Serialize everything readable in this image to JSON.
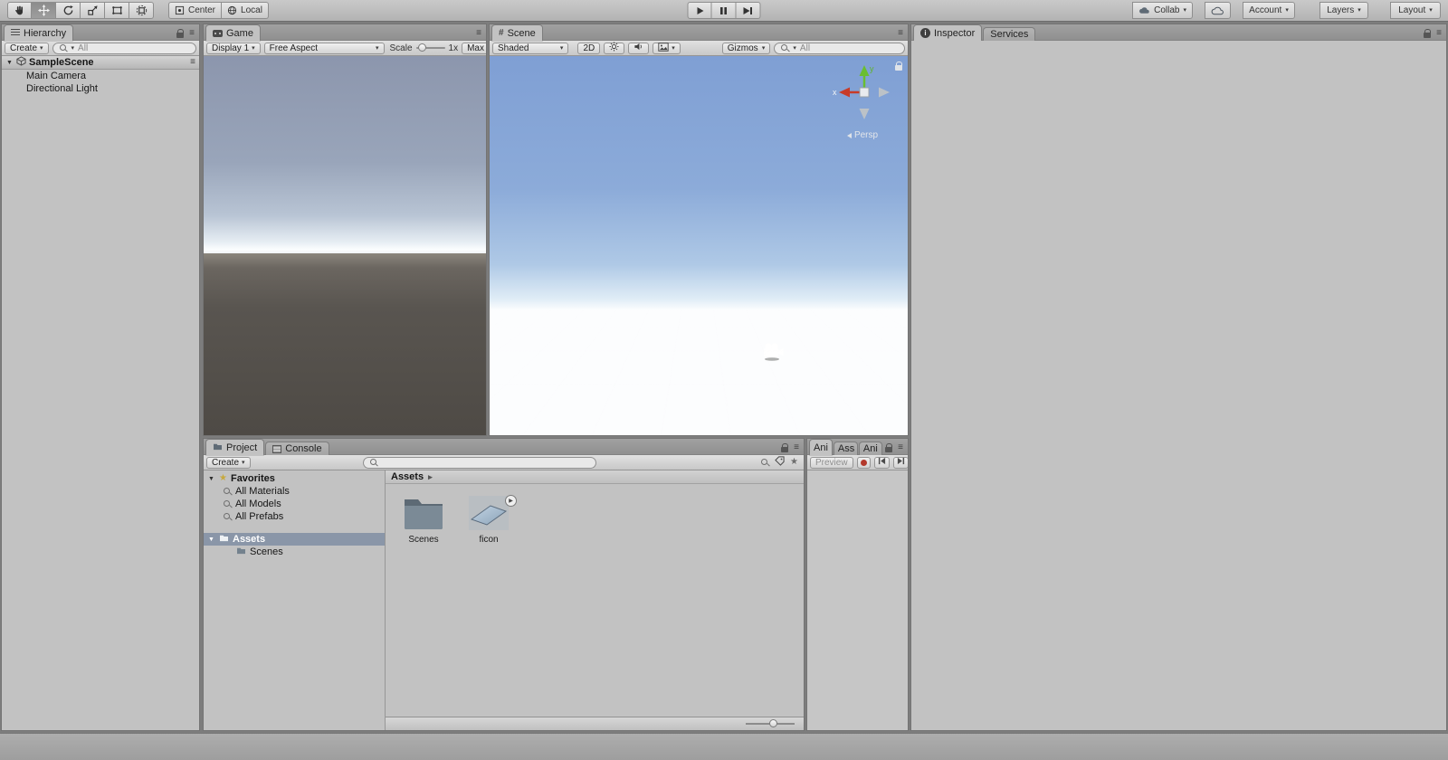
{
  "toolbar": {
    "pivot_label": "Center",
    "space_label": "Local",
    "collab_label": "Collab",
    "account_label": "Account",
    "layers_label": "Layers",
    "layout_label": "Layout"
  },
  "hierarchy": {
    "tab_label": "Hierarchy",
    "create_label": "Create",
    "search_placeholder": "All",
    "scene_name": "SampleScene",
    "items": [
      {
        "label": "Main Camera"
      },
      {
        "label": "Directional Light"
      }
    ]
  },
  "game": {
    "tab_label": "Game",
    "display_label": "Display 1",
    "aspect_label": "Free Aspect",
    "scale_label": "Scale",
    "scale_value": "1x",
    "maximize_label": "Max"
  },
  "scene": {
    "tab_label": "Scene",
    "shading_label": "Shaded",
    "mode_2d_label": "2D",
    "gizmos_label": "Gizmos",
    "search_placeholder": "All",
    "persp_label": "Persp",
    "axis_x_label": "x",
    "axis_y_label": "y"
  },
  "project": {
    "tab_label": "Project",
    "console_tab_label": "Console",
    "create_label": "Create",
    "favorites_label": "Favorites",
    "favorites_items": [
      {
        "label": "All Materials"
      },
      {
        "label": "All Models"
      },
      {
        "label": "All Prefabs"
      }
    ],
    "assets_label": "Assets",
    "assets_children": [
      {
        "label": "Scenes"
      }
    ],
    "breadcrumb_label": "Assets",
    "assets": [
      {
        "name": "Scenes",
        "icon": "folder-icon"
      },
      {
        "name": "ficon",
        "icon": "mesh-plane-icon"
      }
    ]
  },
  "side_panel": {
    "tabs": [
      {
        "label": "Ani"
      },
      {
        "label": "Ass"
      },
      {
        "label": "Ani"
      }
    ],
    "preview_label": "Preview"
  },
  "inspector": {
    "tab_label": "Inspector",
    "services_tab_label": "Services"
  },
  "colors": {
    "panel_bg": "#c2c2c2",
    "selection_gray": "#8a96a8",
    "axis_green": "#6abe30",
    "axis_red": "#c83b28",
    "record_red": "#b3392c",
    "scene_sky_top": "#7f9fd4",
    "ground": "#514d48"
  }
}
